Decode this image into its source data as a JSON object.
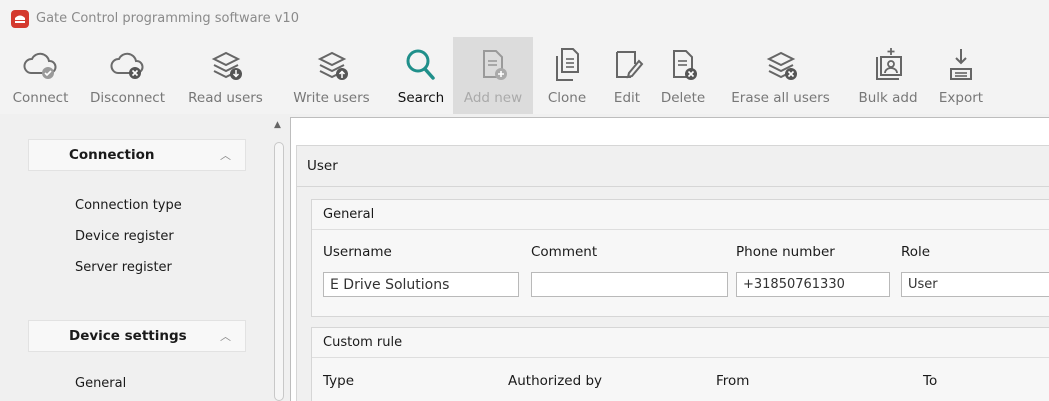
{
  "window": {
    "title": "Gate Control programming software v10"
  },
  "toolbar": [
    {
      "label": "Connect",
      "icon": "cloud-check-icon"
    },
    {
      "label": "Disconnect",
      "icon": "cloud-x-icon"
    },
    {
      "label": "Read users",
      "icon": "layers-download-icon"
    },
    {
      "label": "Write users",
      "icon": "layers-upload-icon"
    },
    {
      "label": "Search",
      "icon": "search-icon"
    },
    {
      "label": "Add new",
      "icon": "document-add-icon"
    },
    {
      "label": "Clone",
      "icon": "documents-copy-icon"
    },
    {
      "label": "Edit",
      "icon": "document-edit-icon"
    },
    {
      "label": "Delete",
      "icon": "document-delete-icon"
    },
    {
      "label": "Erase all users",
      "icon": "layers-erase-icon"
    },
    {
      "label": "Bulk add",
      "icon": "bulk-add-icon"
    },
    {
      "label": "Export",
      "icon": "export-icon"
    }
  ],
  "sidebar": {
    "connection": {
      "title": "Connection",
      "items": [
        "Connection type",
        "Device register",
        "Server register"
      ]
    },
    "device_settings": {
      "title": "Device settings",
      "items": [
        "General"
      ]
    }
  },
  "user_panel": {
    "title": "User",
    "general": {
      "title": "General",
      "username_label": "Username",
      "username_value": "E Drive Solutions",
      "comment_label": "Comment",
      "comment_value": "",
      "phone_label": "Phone number",
      "phone_value": "+31850761330",
      "role_label": "Role",
      "role_value": "User"
    },
    "custom_rule": {
      "title": "Custom rule",
      "type_label": "Type",
      "authorized_by_label": "Authorized by",
      "from_label": "From",
      "to_label": "To"
    }
  },
  "colors": {
    "accent_teal": "#1f8f8a",
    "brand_red": "#d43a2f"
  }
}
